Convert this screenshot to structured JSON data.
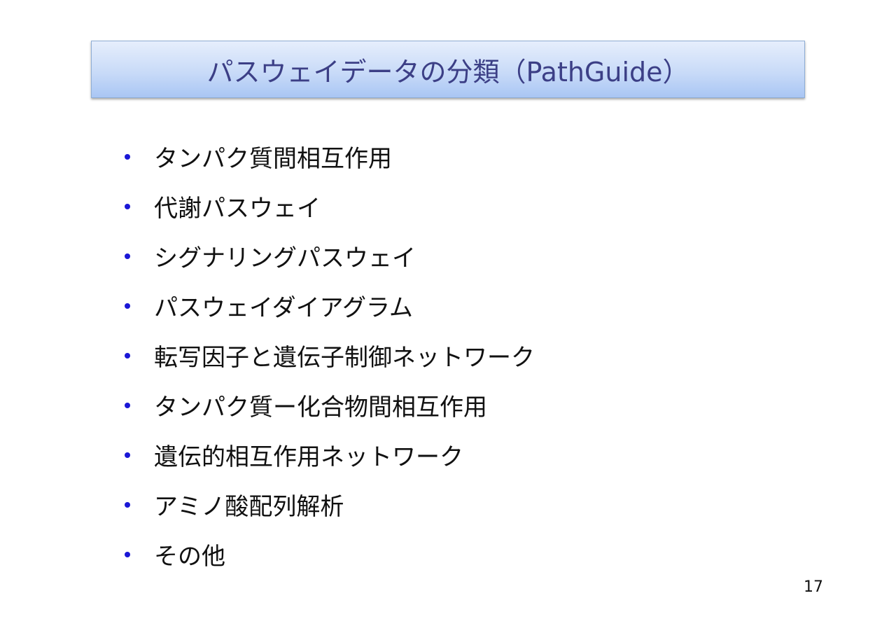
{
  "slide": {
    "title": "パスウェイデータの分類（PathGuide）",
    "bullets": [
      "タンパク質間相互作用",
      "代謝パスウェイ",
      "シグナリングパスウェイ",
      "パスウェイダイアグラム",
      "転写因子と遺伝子制御ネットワーク",
      "タンパク質ー化合物間相互作用",
      "遺伝的相互作用ネットワーク",
      "アミノ酸配列解析",
      "その他"
    ],
    "page_number": "17"
  },
  "colors": {
    "title_text": "#3c3f86",
    "title_box_top": "#e6eefc",
    "title_box_bottom": "#a9c6f4",
    "bullet_dot": "#1a17d6",
    "body_text": "#111111"
  }
}
